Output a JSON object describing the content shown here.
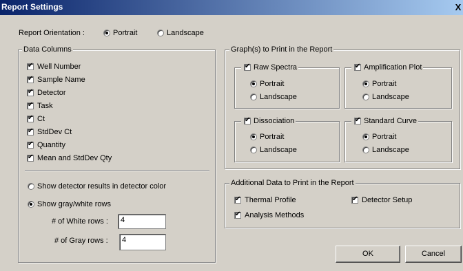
{
  "window": {
    "title": "Report Settings",
    "close_glyph": "X"
  },
  "orientation": {
    "label": "Report Orientation :",
    "options": [
      {
        "label": "Portrait",
        "selected": true
      },
      {
        "label": "Landscape",
        "selected": false
      }
    ]
  },
  "data_columns": {
    "title": "Data Columns",
    "items": [
      {
        "label": "Well Number",
        "checked": true
      },
      {
        "label": "Sample Name",
        "checked": true
      },
      {
        "label": "Detector",
        "checked": true
      },
      {
        "label": "Task",
        "checked": true
      },
      {
        "label": "Ct",
        "checked": true
      },
      {
        "label": "StdDev Ct",
        "checked": true
      },
      {
        "label": "Quantity",
        "checked": true
      },
      {
        "label": "Mean and StdDev Qty",
        "checked": true
      }
    ],
    "color_options": [
      {
        "label": "Show detector results in detector color",
        "selected": false
      },
      {
        "label": "Show gray/white rows",
        "selected": true
      }
    ],
    "white_rows": {
      "label": "# of White rows :",
      "value": "4"
    },
    "gray_rows": {
      "label": "# of Gray rows :",
      "value": "4"
    }
  },
  "graphs": {
    "title": "Graph(s) to Print in the Report",
    "raw_spectra": {
      "label": "Raw Spectra",
      "checked": true,
      "portrait": "Portrait",
      "landscape": "Landscape"
    },
    "amplification": {
      "label": "Amplification Plot",
      "checked": true,
      "portrait": "Portrait",
      "landscape": "Landscape"
    },
    "dissociation": {
      "label": "Dissociation",
      "checked": true,
      "portrait": "Portrait",
      "landscape": "Landscape"
    },
    "standard_curve": {
      "label": "Standard Curve",
      "checked": true,
      "portrait": "Portrait",
      "landscape": "Landscape"
    }
  },
  "additional": {
    "title": "Additional Data to Print in the Report",
    "thermal_profile": {
      "label": "Thermal Profile",
      "checked": true
    },
    "detector_setup": {
      "label": "Detector Setup",
      "checked": true
    },
    "analysis_methods": {
      "label": "Analysis Methods",
      "checked": true
    }
  },
  "buttons": {
    "ok": "OK",
    "cancel": "Cancel"
  }
}
